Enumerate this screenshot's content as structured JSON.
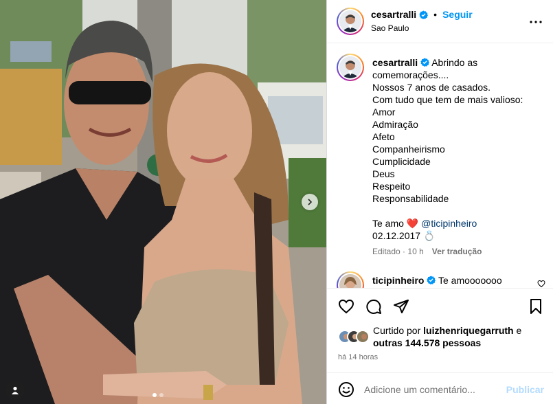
{
  "post": {
    "author": "cesartralli",
    "follow_label": "Seguir",
    "separator": "•",
    "location": "Sao Paulo",
    "caption": {
      "author": "cesartralli",
      "lines": [
        "Abrindo as",
        "comemorações....",
        "Nossos 7 anos de casados.",
        "Com tudo que tem de mais valioso:",
        "Amor",
        "Admiração",
        "Afeto",
        "Companheirismo",
        "Cumplicidade",
        "Deus",
        "Respeito",
        "Responsabilidade"
      ],
      "love_prefix": "Te amo",
      "heart_emoji": "❤️",
      "mention": "@ticipinheiro",
      "date_line": "02.12.2017",
      "ring_emoji": "💍",
      "edited_label": "Editado",
      "separator": "·",
      "edited_time": "10 h",
      "translate_label": "Ver tradução"
    },
    "comment": {
      "author": "ticipinheiro",
      "text": "Te amooooooo"
    },
    "likes": {
      "prefix": "Curtido por",
      "user": "luizhenriquegarruth",
      "and": "e",
      "others": "outras 144.578 pessoas"
    },
    "time_ago": "há 14 horas",
    "comment_box": {
      "placeholder": "Adicione um comentário...",
      "publish_label": "Publicar"
    }
  },
  "colors": {
    "accent_blue": "#0095f6",
    "verified_blue": "#0095f6",
    "muted_text": "#737373",
    "publish_disabled": "#b3dbff"
  },
  "icons": [
    "verified-badge-icon",
    "more-options-icon",
    "heart-icon",
    "comment-icon",
    "share-icon",
    "save-icon",
    "emoji-icon",
    "next-arrow-icon",
    "user-tag-icon"
  ]
}
